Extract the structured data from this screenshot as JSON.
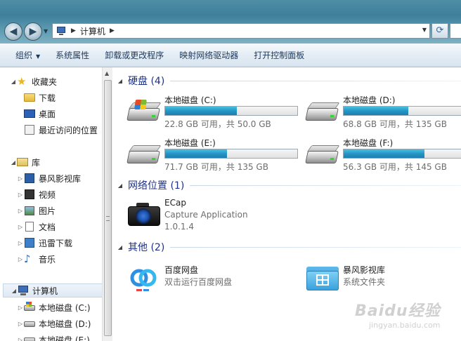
{
  "address_bar": {
    "path": "计算机"
  },
  "toolbar": {
    "organize": "组织",
    "system_properties": "系统属性",
    "uninstall": "卸载或更改程序",
    "map_drive": "映射网络驱动器",
    "control_panel": "打开控制面板"
  },
  "nav": {
    "favorites": "收藏夹",
    "downloads": "下载",
    "desktop": "桌面",
    "recent": "最近访问的位置",
    "libraries": "库",
    "lib_baofeng": "暴风影视库",
    "lib_video": "视频",
    "lib_pictures": "图片",
    "lib_docs": "文档",
    "lib_xunlei": "迅雷下载",
    "lib_music": "音乐",
    "computer": "计算机",
    "disk_c": "本地磁盘 (C:)",
    "disk_d": "本地磁盘 (D:)",
    "disk_e": "本地磁盘 (E:)"
  },
  "groups": {
    "hdd": "硬盘 (4)",
    "network": "网络位置 (1)",
    "other": "其他 (2)"
  },
  "drives": [
    {
      "name": "本地磁盘 (C:)",
      "free": "22.8 GB 可用，共 50.0 GB",
      "used_fraction": 0.544
    },
    {
      "name": "本地磁盘 (D:)",
      "free": "68.8 GB 可用，共 135 GB",
      "used_fraction": 0.49
    },
    {
      "name": "本地磁盘 (E:)",
      "free": "71.7 GB 可用，共 135 GB",
      "used_fraction": 0.469
    },
    {
      "name": "本地磁盘 (F:)",
      "free": "56.3 GB 可用，共 145 GB",
      "used_fraction": 0.612
    }
  ],
  "network_item": {
    "name": "ECap",
    "desc": "Capture Application",
    "version": "1.0.1.4"
  },
  "other_items": [
    {
      "name": "百度网盘",
      "desc": "双击运行百度网盘"
    },
    {
      "name": "暴风影视库",
      "desc": "系统文件夹"
    }
  ],
  "watermark": {
    "brand": "Baidu经验",
    "url": "jingyan.baidu.com"
  }
}
